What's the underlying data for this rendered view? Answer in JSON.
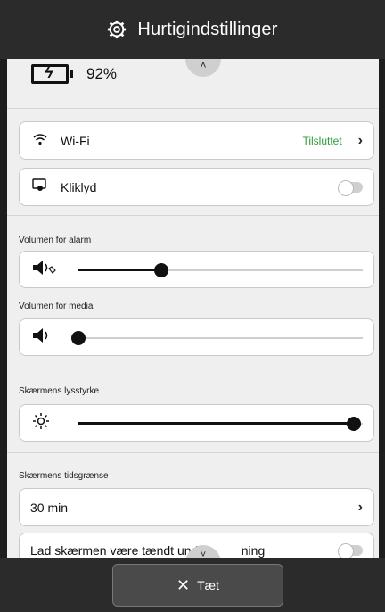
{
  "header": {
    "title": "Hurtigindstillinger"
  },
  "battery": {
    "percent": "92%"
  },
  "wifi": {
    "label": "Wi-Fi",
    "status": "Tilsluttet",
    "status_color": "#2e9b3a"
  },
  "click_sound": {
    "label": "Kliklyd",
    "enabled": false
  },
  "alarm_volume": {
    "label": "Volumen for alarm",
    "level": 0.29
  },
  "media_volume": {
    "label": "Volumen for media",
    "level": 0.0
  },
  "brightness": {
    "label": "Skærmens lysstyrke",
    "level": 0.97
  },
  "screen_timeout": {
    "label": "Skærmens tidsgrænse",
    "value": "30 min"
  },
  "keep_screen_on": {
    "label_part1": "Lad skærmen være tændt under",
    "label_part2": "ning",
    "enabled": false
  },
  "footer": {
    "close_label": "Tæt"
  },
  "icons": {
    "gear": "gear-icon",
    "battery": "battery-charging-icon",
    "wifi": "wifi-icon",
    "click": "touch-icon",
    "speaker": "speaker-icon",
    "sun": "brightness-icon",
    "close": "close-icon"
  }
}
